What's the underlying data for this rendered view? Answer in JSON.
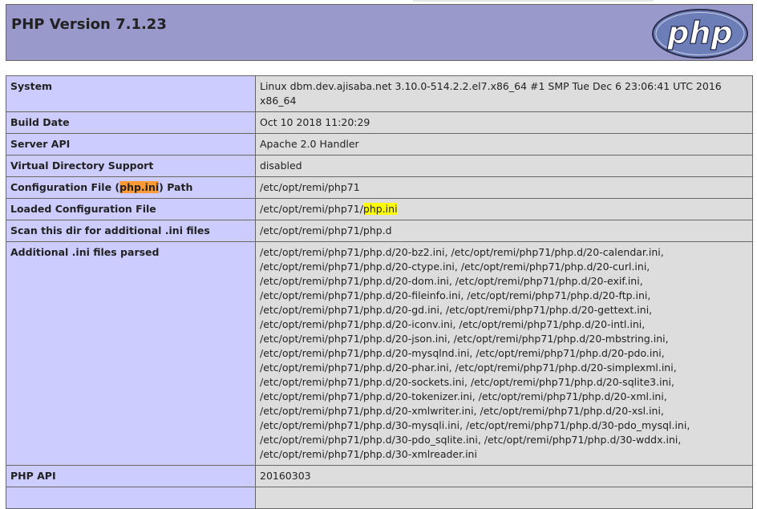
{
  "header": {
    "title": "PHP Version 7.1.23",
    "logo_text": "php"
  },
  "colors": {
    "header_bg": "#9999cc",
    "key_bg": "#ccccff",
    "value_bg": "#dddddd",
    "highlight_orange": "#ff9933",
    "highlight_yellow": "#ffff00"
  },
  "rows": [
    {
      "key": "System",
      "value": "Linux dbm.dev.ajisaba.net 3.10.0-514.2.2.el7.x86_64 #1 SMP Tue Dec 6 23:06:41 UTC 2016 x86_64"
    },
    {
      "key": "Build Date",
      "value": "Oct 10 2018 11:20:29"
    },
    {
      "key": "Server API",
      "value": "Apache 2.0 Handler"
    },
    {
      "key": "Virtual Directory Support",
      "value": "disabled"
    },
    {
      "key_pre": "Configuration File (",
      "key_hl": "php.ini",
      "key_post": ") Path",
      "value": "/etc/opt/remi/php71"
    },
    {
      "key": "Loaded Configuration File",
      "value_pre": "/etc/opt/remi/php71/",
      "value_hl": "php.ini"
    },
    {
      "key": "Scan this dir for additional .ini files",
      "value": "/etc/opt/remi/php71/php.d"
    },
    {
      "key": "Additional .ini files parsed",
      "lines": [
        "/etc/opt/remi/php71/php.d/20-bz2.ini, /etc/opt/remi/php71/php.d/20-calendar.ini,",
        "/etc/opt/remi/php71/php.d/20-ctype.ini, /etc/opt/remi/php71/php.d/20-curl.ini,",
        "/etc/opt/remi/php71/php.d/20-dom.ini, /etc/opt/remi/php71/php.d/20-exif.ini,",
        "/etc/opt/remi/php71/php.d/20-fileinfo.ini, /etc/opt/remi/php71/php.d/20-ftp.ini,",
        "/etc/opt/remi/php71/php.d/20-gd.ini, /etc/opt/remi/php71/php.d/20-gettext.ini,",
        "/etc/opt/remi/php71/php.d/20-iconv.ini, /etc/opt/remi/php71/php.d/20-intl.ini,",
        "/etc/opt/remi/php71/php.d/20-json.ini, /etc/opt/remi/php71/php.d/20-mbstring.ini,",
        "/etc/opt/remi/php71/php.d/20-mysqlnd.ini, /etc/opt/remi/php71/php.d/20-pdo.ini,",
        "/etc/opt/remi/php71/php.d/20-phar.ini, /etc/opt/remi/php71/php.d/20-simplexml.ini,",
        "/etc/opt/remi/php71/php.d/20-sockets.ini, /etc/opt/remi/php71/php.d/20-sqlite3.ini,",
        "/etc/opt/remi/php71/php.d/20-tokenizer.ini, /etc/opt/remi/php71/php.d/20-xml.ini,",
        "/etc/opt/remi/php71/php.d/20-xmlwriter.ini, /etc/opt/remi/php71/php.d/20-xsl.ini,",
        "/etc/opt/remi/php71/php.d/30-mysqli.ini, /etc/opt/remi/php71/php.d/30-pdo_mysql.ini,",
        "/etc/opt/remi/php71/php.d/30-pdo_sqlite.ini, /etc/opt/remi/php71/php.d/30-wddx.ini,",
        "/etc/opt/remi/php71/php.d/30-xmlreader.ini"
      ]
    },
    {
      "key": "PHP API",
      "value": "20160303"
    }
  ]
}
